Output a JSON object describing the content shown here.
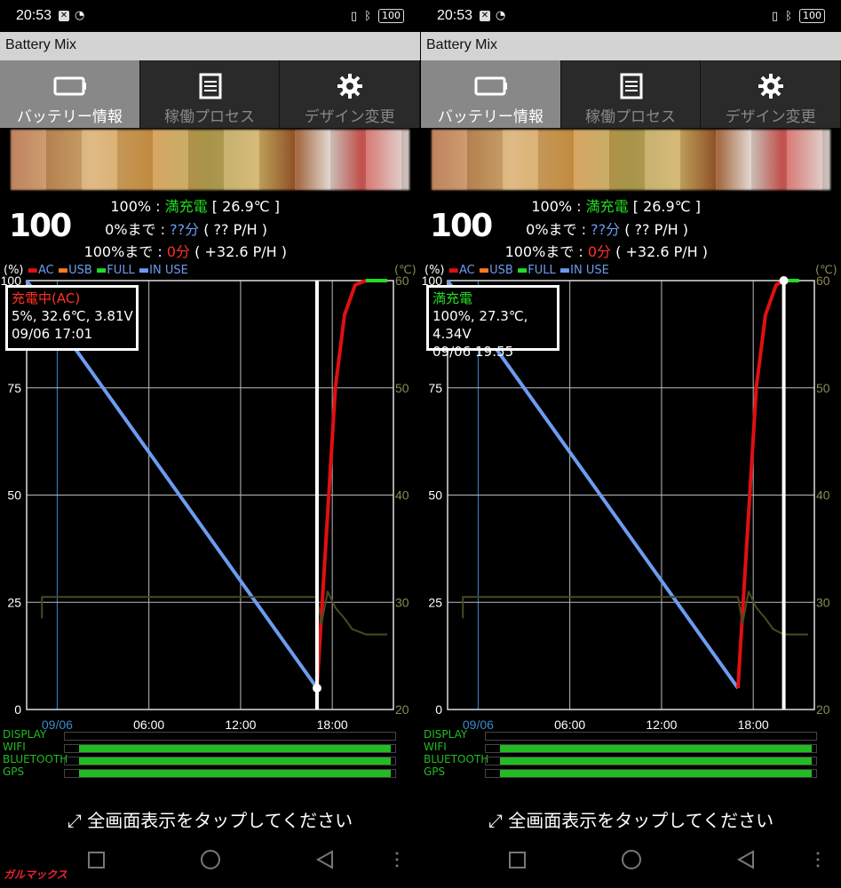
{
  "screens": [
    {
      "id": "left",
      "status": {
        "time": "20:53",
        "battery": "100"
      },
      "app_title": "Battery Mix",
      "tabs": [
        {
          "label": "バッテリー情報",
          "icon": "battery-icon",
          "active": true
        },
        {
          "label": "稼働プロセス",
          "icon": "list-icon",
          "active": false
        },
        {
          "label": "デザイン変更",
          "icon": "gear-icon",
          "active": false
        }
      ],
      "battery_level": "100",
      "info": {
        "line1_prefix": "100% : ",
        "line1_status": "満充電",
        "line1_suffix": " [ 26.9℃ ]",
        "line2_prefix": "0%まで : ",
        "line2_value": "??分",
        "line2_suffix": " ( ?? P/H )",
        "line3_prefix": "100%まで : ",
        "line3_value": "0分",
        "line3_suffix": " ( +32.6 P/H )"
      },
      "legend": {
        "unit_left": "(%)",
        "ac": "AC",
        "usb": "USB",
        "full": "FULL",
        "in_use": "IN USE",
        "unit_right": "(℃)"
      },
      "callout": {
        "title": "充電中(AC)",
        "title_color": "#ff3322",
        "line1": "5%, 32.6℃, 3.81V",
        "line2": "09/06 17:01"
      },
      "usage": {
        "display": "DISPLAY",
        "wifi": "WIFI",
        "bluetooth": "BLUETOOTH",
        "gps": "GPS"
      },
      "fullscreen_text": "全画面表示をタップしてください"
    },
    {
      "id": "right",
      "status": {
        "time": "20:53",
        "battery": "100"
      },
      "app_title": "Battery Mix",
      "tabs": [
        {
          "label": "バッテリー情報",
          "icon": "battery-icon",
          "active": true
        },
        {
          "label": "稼働プロセス",
          "icon": "list-icon",
          "active": false
        },
        {
          "label": "デザイン変更",
          "icon": "gear-icon",
          "active": false
        }
      ],
      "battery_level": "100",
      "info": {
        "line1_prefix": "100% : ",
        "line1_status": "満充電",
        "line1_suffix": " [ 26.9℃ ]",
        "line2_prefix": "0%まで : ",
        "line2_value": "??分",
        "line2_suffix": " ( ?? P/H )",
        "line3_prefix": "100%まで : ",
        "line3_value": "0分",
        "line3_suffix": " ( +32.6 P/H )"
      },
      "legend": {
        "unit_left": "(%)",
        "ac": "AC",
        "usb": "USB",
        "full": "FULL",
        "in_use": "IN USE",
        "unit_right": "(℃)"
      },
      "callout": {
        "title": "満充電",
        "title_color": "#22dd22",
        "line1": "100%, 27.3℃, 4.34V",
        "line2": "09/06 19:55"
      },
      "usage": {
        "display": "DISPLAY",
        "wifi": "WIFI",
        "bluetooth": "BLUETOOTH",
        "gps": "GPS"
      },
      "fullscreen_text": "全画面表示をタップしてください"
    }
  ],
  "chart_data": [
    {
      "type": "line",
      "x_tick_labels": [
        "09/06",
        "06:00",
        "12:00",
        "18:00"
      ],
      "y_ticks_left": [
        "100",
        "75",
        "50",
        "25",
        "0"
      ],
      "y_ticks_right": [
        "60",
        "50",
        "40",
        "30",
        "20"
      ],
      "ylim": [
        0,
        100
      ],
      "y2lim": [
        20,
        60
      ],
      "xlim_hours": [
        -2,
        22
      ],
      "series": [
        {
          "name": "IN USE",
          "color": "#6c9cf0",
          "x_hours": [
            -2,
            17.0
          ],
          "y": [
            100,
            5
          ]
        },
        {
          "name": "AC",
          "color": "#e01010",
          "x_hours": [
            17.0,
            17.6,
            18.2,
            18.8,
            19.5,
            20.2
          ],
          "y": [
            5,
            40,
            75,
            92,
            99,
            100
          ]
        },
        {
          "name": "FULL",
          "color": "#22dd22",
          "x_hours": [
            20.2,
            21.6
          ],
          "y": [
            100,
            100
          ]
        },
        {
          "name": "temperature",
          "color": "#4a4a22",
          "x_hours": [
            -1,
            -1,
            17,
            17.3,
            17.7,
            18.2,
            18.8,
            19.3,
            20.2,
            21.6
          ],
          "y2": [
            28.5,
            30.5,
            30.5,
            28,
            31,
            29.5,
            28.5,
            27.5,
            27,
            27
          ]
        }
      ],
      "cursor_x_hours": 17.0,
      "cursor_y": 5,
      "usage_bars": [
        {
          "name": "DISPLAY",
          "segments": []
        },
        {
          "name": "WIFI",
          "segments": [
            [
              -1,
              21.7
            ]
          ]
        },
        {
          "name": "BLUETOOTH",
          "segments": [
            [
              -1,
              21.7
            ]
          ]
        },
        {
          "name": "GPS",
          "segments": [
            [
              -1,
              21.7
            ]
          ]
        }
      ]
    },
    {
      "type": "line",
      "x_tick_labels": [
        "09/06",
        "06:00",
        "12:00",
        "18:00"
      ],
      "y_ticks_left": [
        "100",
        "75",
        "50",
        "25",
        "0"
      ],
      "y_ticks_right": [
        "60",
        "50",
        "40",
        "30",
        "20"
      ],
      "ylim": [
        0,
        100
      ],
      "y2lim": [
        20,
        60
      ],
      "xlim_hours": [
        -2,
        22
      ],
      "series": [
        {
          "name": "IN USE",
          "color": "#6c9cf0",
          "x_hours": [
            -2,
            17.0
          ],
          "y": [
            100,
            5
          ]
        },
        {
          "name": "AC",
          "color": "#e01010",
          "x_hours": [
            17.0,
            17.6,
            18.2,
            18.8,
            19.5,
            20.0
          ],
          "y": [
            5,
            40,
            75,
            92,
            99,
            100
          ]
        },
        {
          "name": "FULL",
          "color": "#22dd22",
          "x_hours": [
            20.0,
            21.0
          ],
          "y": [
            100,
            100
          ]
        },
        {
          "name": "temperature",
          "color": "#4a4a22",
          "x_hours": [
            -1,
            -1,
            17,
            17.3,
            17.7,
            18.2,
            18.8,
            19.3,
            20.0,
            21.6
          ],
          "y2": [
            28.5,
            30.5,
            30.5,
            28,
            31,
            29.5,
            28.5,
            27.5,
            27,
            27
          ]
        }
      ],
      "cursor_x_hours": 20.0,
      "cursor_y": 100,
      "usage_bars": [
        {
          "name": "DISPLAY",
          "segments": []
        },
        {
          "name": "WIFI",
          "segments": [
            [
              -1,
              21.7
            ]
          ]
        },
        {
          "name": "BLUETOOTH",
          "segments": [
            [
              -1,
              21.7
            ]
          ]
        },
        {
          "name": "GPS",
          "segments": [
            [
              -1,
              21.7
            ]
          ]
        }
      ]
    }
  ],
  "watermark": "ガルマックス"
}
